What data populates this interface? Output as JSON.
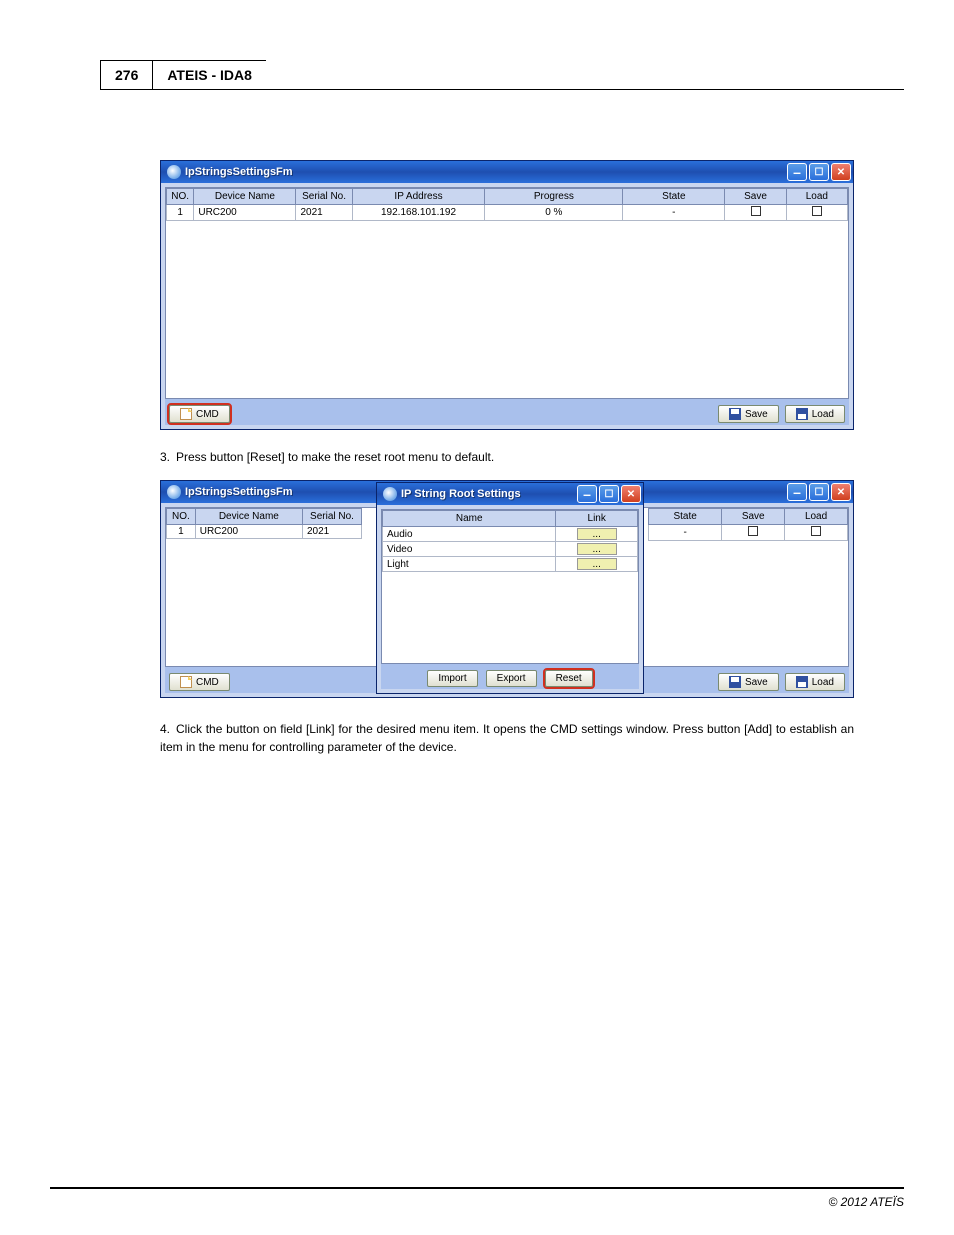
{
  "header": {
    "page_number": "276",
    "doc_title": "ATEIS - IDA8"
  },
  "screenshot1": {
    "window_title": "IpStringsSettingsFm",
    "columns": [
      "NO.",
      "Device Name",
      "Serial No.",
      "IP Address",
      "Progress",
      "State",
      "Save",
      "Load"
    ],
    "row": {
      "no": "1",
      "device_name": "URC200",
      "serial_no": "2021",
      "ip": "192.168.101.192",
      "progress": "0 %",
      "state": "-"
    },
    "btn_cmd": "CMD",
    "btn_save": "Save",
    "btn_load": "Load"
  },
  "instr3": "Press button [Reset] to make the reset root menu to default.",
  "screenshot2": {
    "bg": {
      "window_title": "IpStringsSettingsFm",
      "columns_left": [
        "NO.",
        "Device Name",
        "Serial No."
      ],
      "columns_right": [
        "State",
        "Save",
        "Load"
      ],
      "row": {
        "no": "1",
        "device_name": "URC200",
        "serial_no": "2021",
        "state": "-"
      },
      "btn_cmd": "CMD",
      "btn_save": "Save",
      "btn_load": "Load"
    },
    "fg": {
      "window_title": "IP String Root Settings",
      "columns": [
        "Name",
        "Link"
      ],
      "rows": [
        "Audio",
        "Video",
        "Light"
      ],
      "link_label": "...",
      "btn_import": "Import",
      "btn_export": "Export",
      "btn_reset": "Reset"
    }
  },
  "instr4": "Click the button on field [Link] for the desired menu item. It opens the CMD settings window. Press button [Add] to establish an item in the menu for controlling parameter of the device.",
  "footer": "© 2012 ATEÏS"
}
